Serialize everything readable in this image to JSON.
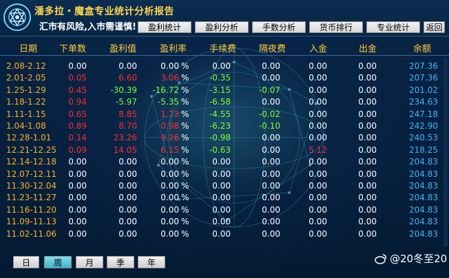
{
  "header": {
    "title": "潘多拉・魔盒专业统计分析报告",
    "subtitle": "汇市有风险,入市需谨慎!",
    "tabs": [
      "盈利统计",
      "盈利分析",
      "手数分析",
      "货币排行",
      "专业统计",
      "返回"
    ]
  },
  "columns": [
    "日期",
    "下单数",
    "盈利值",
    "盈利率",
    "手续费",
    "隔夜费",
    "入金",
    "出金",
    "余额"
  ],
  "rows": [
    {
      "date": "2.08-2.12",
      "orders": "0.00",
      "profit": "0.00",
      "rate": "0.00",
      "fee": "0.00",
      "swap": "0.00",
      "deposit": "0.00",
      "withdraw": "0.00",
      "balance": "207.36",
      "c": [
        "w",
        "w",
        "w",
        "w",
        "w",
        "w"
      ]
    },
    {
      "date": "2.01-2.05",
      "orders": "0.05",
      "profit": "6.60",
      "rate": "3.06",
      "fee": "-0.35",
      "swap": "0.00",
      "deposit": "0.00",
      "withdraw": "0.00",
      "balance": "207.36",
      "c": [
        "red",
        "red",
        "red",
        "grn",
        "w",
        "w"
      ]
    },
    {
      "date": "1.25-1.29",
      "orders": "0.45",
      "profit": "-30.39",
      "rate": "-16.72",
      "fee": "-3.15",
      "swap": "-0.07",
      "deposit": "0.00",
      "withdraw": "0.00",
      "balance": "201.02",
      "c": [
        "red",
        "grn",
        "grn",
        "grn",
        "grn",
        "w"
      ]
    },
    {
      "date": "1.18-1.22",
      "orders": "0.94",
      "profit": "-5.97",
      "rate": "-5.35",
      "fee": "-6.58",
      "swap": "0.00",
      "deposit": "0.00",
      "withdraw": "0.00",
      "balance": "234.63",
      "c": [
        "red",
        "grn",
        "grn",
        "grn",
        "w",
        "w"
      ]
    },
    {
      "date": "1.11-1.15",
      "orders": "0.65",
      "profit": "8.85",
      "rate": "1.73",
      "fee": "-4.55",
      "swap": "-0.02",
      "deposit": "0.00",
      "withdraw": "0.00",
      "balance": "247.18",
      "c": [
        "red",
        "red",
        "red",
        "grn",
        "grn",
        "w"
      ]
    },
    {
      "date": "1.04-1.08",
      "orders": "0.89",
      "profit": "8.70",
      "rate": "0.98",
      "fee": "-6.23",
      "swap": "-0.10",
      "deposit": "0.00",
      "withdraw": "0.00",
      "balance": "242.90",
      "c": [
        "red",
        "red",
        "red",
        "grn",
        "grn",
        "w"
      ]
    },
    {
      "date": "12.28-1.01",
      "orders": "0.14",
      "profit": "23.26",
      "rate": "9.26",
      "fee": "-0.98",
      "swap": "0.00",
      "deposit": "0.00",
      "withdraw": "0.00",
      "balance": "240.53",
      "c": [
        "red",
        "red",
        "red",
        "grn",
        "w",
        "w"
      ]
    },
    {
      "date": "12.21-12.25",
      "orders": "0.09",
      "profit": "14.05",
      "rate": "6.15",
      "fee": "-0.63",
      "swap": "0.00",
      "deposit": "5.12",
      "withdraw": "0.00",
      "balance": "218.25",
      "c": [
        "red",
        "red",
        "red",
        "grn",
        "w",
        "red"
      ]
    },
    {
      "date": "12.14-12.18",
      "orders": "0.00",
      "profit": "0.00",
      "rate": "0.00",
      "fee": "0.00",
      "swap": "0.00",
      "deposit": "0.00",
      "withdraw": "0.00",
      "balance": "204.83",
      "c": [
        "w",
        "w",
        "w",
        "w",
        "w",
        "w"
      ]
    },
    {
      "date": "12.07-12.11",
      "orders": "0.00",
      "profit": "0.00",
      "rate": "0.00",
      "fee": "0.00",
      "swap": "0.00",
      "deposit": "0.00",
      "withdraw": "0.00",
      "balance": "204.83",
      "c": [
        "w",
        "w",
        "w",
        "w",
        "w",
        "w"
      ]
    },
    {
      "date": "11.30-12.04",
      "orders": "0.00",
      "profit": "0.00",
      "rate": "0.00",
      "fee": "0.00",
      "swap": "0.00",
      "deposit": "0.00",
      "withdraw": "0.00",
      "balance": "204.83",
      "c": [
        "w",
        "w",
        "w",
        "w",
        "w",
        "w"
      ]
    },
    {
      "date": "11.23-11.27",
      "orders": "0.00",
      "profit": "0.00",
      "rate": "0.00",
      "fee": "0.00",
      "swap": "0.00",
      "deposit": "0.00",
      "withdraw": "0.00",
      "balance": "204.83",
      "c": [
        "w",
        "w",
        "w",
        "w",
        "w",
        "w"
      ]
    },
    {
      "date": "11.16-11.20",
      "orders": "0.00",
      "profit": "0.00",
      "rate": "0.00",
      "fee": "0.00",
      "swap": "0.00",
      "deposit": "0.00",
      "withdraw": "0.00",
      "balance": "204.83",
      "c": [
        "w",
        "w",
        "w",
        "w",
        "w",
        "w"
      ]
    },
    {
      "date": "11.09-11.13",
      "orders": "0.00",
      "profit": "0.00",
      "rate": "0.00",
      "fee": "0.00",
      "swap": "0.00",
      "deposit": "0.00",
      "withdraw": "0.00",
      "balance": "204.83",
      "c": [
        "w",
        "w",
        "w",
        "w",
        "w",
        "w"
      ]
    },
    {
      "date": "11.02-11.06",
      "orders": "0.00",
      "profit": "0.00",
      "rate": "0.00",
      "fee": "0.00",
      "swap": "0.00",
      "deposit": "0.00",
      "withdraw": "0.00",
      "balance": "204.83",
      "c": [
        "w",
        "w",
        "w",
        "w",
        "w",
        "w"
      ]
    }
  ],
  "percent_sign": "%",
  "periods": [
    "日",
    "周",
    "月",
    "季",
    "年"
  ],
  "active_period": "周",
  "watermark": "@20冬至20",
  "colors": {
    "accent_gold": "#ffcf3a",
    "date_orange": "#ffb21f",
    "loss_red": "#ff2b2b",
    "gain_green": "#7dff2a",
    "balance_blue": "#3fb6ff",
    "background": "#061a33"
  }
}
